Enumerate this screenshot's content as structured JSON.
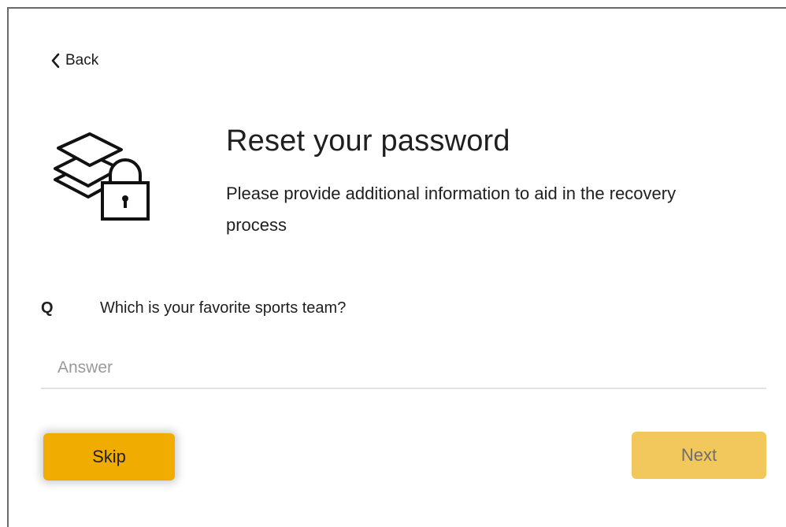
{
  "nav": {
    "back_label": "Back"
  },
  "header": {
    "title": "Reset your password",
    "subtitle": "Please provide additional information to aid in the recovery process"
  },
  "security_question": {
    "marker": "Q",
    "text": "Which is your favorite sports team?",
    "answer_value": "",
    "answer_placeholder": "Answer"
  },
  "actions": {
    "skip_label": "Skip",
    "next_label": "Next"
  },
  "icons": {
    "back": "chevron-left-icon",
    "illustration": "stacked-layers-lock-icon"
  },
  "colors": {
    "skip_button": "#f0ad00",
    "next_button_disabled": "#f2c75c",
    "input_underline": "#e2e2e2"
  }
}
